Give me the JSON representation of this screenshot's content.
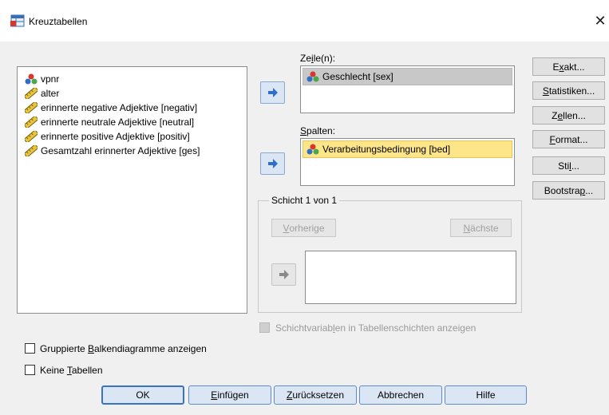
{
  "window": {
    "title": "Kreuztabellen",
    "close_glyph": "✕"
  },
  "source_list": {
    "items": [
      {
        "label": "vpnr",
        "icon": "nominal-icon"
      },
      {
        "label": "alter",
        "icon": "scale-icon"
      },
      {
        "label": "erinnerte negative Adjektive [negativ]",
        "icon": "scale-icon"
      },
      {
        "label": "erinnerte neutrale Adjektive [neutral]",
        "icon": "scale-icon"
      },
      {
        "label": "erinnerte positive Adjektive [positiv]",
        "icon": "scale-icon"
      },
      {
        "label": "Gesamtzahl erinnerter Adjektive [ges]",
        "icon": "scale-icon"
      }
    ]
  },
  "rows": {
    "label_pre": "Ze",
    "label_accel": "i",
    "label_post": "le(n):",
    "item": "Geschlecht [sex]"
  },
  "columns": {
    "label_pre": "",
    "label_accel": "S",
    "label_post": "palten:",
    "item": "Verarbeitungsbedingung [bed]"
  },
  "layer": {
    "legend": "Schicht 1 von 1",
    "prev": {
      "accel": "V",
      "rest": "orherige"
    },
    "next": {
      "accel": "N",
      "rest": "ächste"
    }
  },
  "layer_checkbox": {
    "pre": "Schichtvariab",
    "accel": "l",
    "post": "en in Tabellenschichten anzeigen"
  },
  "side_buttons": [
    {
      "pre": "E",
      "accel": "x",
      "post": "akt..."
    },
    {
      "pre": "",
      "accel": "S",
      "post": "tatistiken..."
    },
    {
      "pre": "Z",
      "accel": "e",
      "post": "llen..."
    },
    {
      "pre": "",
      "accel": "F",
      "post": "ormat..."
    },
    {
      "pre": "Sti",
      "accel": "l",
      "post": "..."
    },
    {
      "pre": "Bootstra",
      "accel": "p",
      "post": "..."
    }
  ],
  "checkboxes": [
    {
      "pre": "Gruppierte ",
      "accel": "B",
      "post": "alkendiagramme anzeigen"
    },
    {
      "pre": "Keine ",
      "accel": "T",
      "post": "abellen"
    }
  ],
  "bottom_buttons": [
    {
      "pre": "OK",
      "accel": "",
      "post": ""
    },
    {
      "pre": "",
      "accel": "E",
      "post": "infügen"
    },
    {
      "pre": "",
      "accel": "Z",
      "post": "urücksetzen"
    },
    {
      "pre": "Abbrechen",
      "accel": "",
      "post": ""
    },
    {
      "pre": "Hilfe",
      "accel": "",
      "post": ""
    }
  ],
  "colors": {
    "dialog_bg": "#f0f0f0",
    "row_selection": "#c8c8c8",
    "column_selection": "#fde58a",
    "accent_button": "#dbe6f4"
  }
}
